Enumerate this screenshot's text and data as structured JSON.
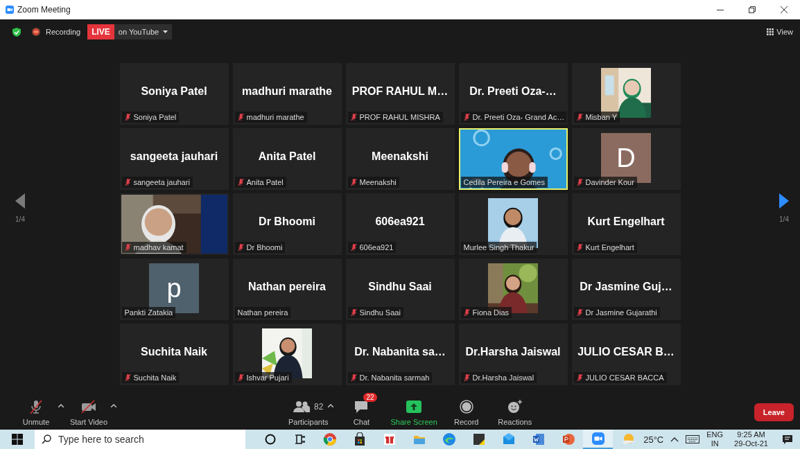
{
  "window": {
    "title": "Zoom Meeting"
  },
  "meeting_bar": {
    "recording": "Recording",
    "live": "LIVE",
    "stream": "on YouTube",
    "view": "View"
  },
  "prev_page": {
    "page": "1/4",
    "disabled": true
  },
  "next_page": {
    "page": "1/4",
    "disabled": false
  },
  "tiles": [
    {
      "kind": "name",
      "display_name": "Soniya Patel",
      "label": "Soniya Patel",
      "muted": true,
      "speaking": false
    },
    {
      "kind": "name",
      "display_name": "madhuri marathe",
      "label": "madhuri marathe",
      "muted": true,
      "speaking": false
    },
    {
      "kind": "name",
      "display_name": "PROF RAHUL M…",
      "label": "PROF RAHUL MISHRA",
      "muted": true,
      "speaking": false
    },
    {
      "kind": "name",
      "display_name": "Dr. Preeti Oza-…",
      "label": "Dr. Preeti Oza- Grand Ac…",
      "muted": true,
      "speaking": false
    },
    {
      "label": "Misban Y",
      "muted": true,
      "speaking": false
    },
    {
      "kind": "name",
      "display_name": "sangeeta jauhari",
      "label": "sangeeta jauhari",
      "muted": true,
      "speaking": false
    },
    {
      "kind": "name",
      "display_name": "Anita Patel",
      "label": "Anita Patel",
      "muted": true,
      "speaking": false
    },
    {
      "kind": "name",
      "display_name": "Meenakshi",
      "label": "Meenakshi",
      "muted": true,
      "speaking": false
    },
    {
      "kind": "video",
      "label": "Cedila Pereira e Gomes",
      "muted": false,
      "speaking": true
    },
    {
      "kind": "avatar",
      "initial": "D",
      "color": "#8b6b60",
      "label": "Davinder Kour",
      "muted": true,
      "speaking": false
    },
    {
      "kind": "video",
      "label": "madhav kamat",
      "muted": true,
      "speaking": false
    },
    {
      "kind": "name",
      "display_name": "Dr Bhoomi",
      "label": "Dr Bhoomi",
      "muted": true,
      "speaking": false
    },
    {
      "kind": "name",
      "display_name": "606ea921",
      "label": "606ea921",
      "muted": true,
      "speaking": false
    },
    {
      "label": "Murlee Singh Thakur",
      "muted": false,
      "speaking": false
    },
    {
      "kind": "name",
      "display_name": "Kurt Engelhart",
      "label": "Kurt Engelhart",
      "muted": true,
      "speaking": false
    },
    {
      "kind": "avatar",
      "initial": "p",
      "color": "#4f616d",
      "label": "Pankti Zatakia",
      "muted": false,
      "speaking": false
    },
    {
      "kind": "name",
      "display_name": "Nathan pereira",
      "label": "Nathan pereira",
      "muted": false,
      "speaking": false
    },
    {
      "kind": "name",
      "display_name": "Sindhu Saai",
      "label": "Sindhu Saai",
      "muted": true,
      "speaking": false
    },
    {
      "label": "Fiona Dias",
      "muted": true,
      "speaking": false
    },
    {
      "kind": "name",
      "display_name": "Dr Jasmine Guj…",
      "label": "Dr Jasmine Gujarathi",
      "muted": true,
      "speaking": false
    },
    {
      "kind": "name",
      "display_name": "Suchita Naik",
      "label": "Suchita Naik",
      "muted": true,
      "speaking": false
    },
    {
      "label": "Ishvar Pujari",
      "muted": true,
      "speaking": false
    },
    {
      "kind": "name",
      "display_name": "Dr. Nabanita sa…",
      "label": "Dr. Nabanita sarmah",
      "muted": true,
      "speaking": false
    },
    {
      "kind": "name",
      "display_name": "Dr.Harsha Jaiswal",
      "label": "Dr.Harsha Jaiswal",
      "muted": true,
      "speaking": false
    },
    {
      "kind": "name",
      "display_name": "JULIO CESAR B…",
      "label": "JULIO CESAR BACCA",
      "muted": true,
      "speaking": false
    }
  ],
  "toolbar": {
    "buttons": [
      {
        "kind": "mic",
        "label": "Unmute"
      },
      {
        "kind": "video",
        "label": "Start Video"
      },
      {
        "kind": "participants",
        "label": "Participants",
        "count": "82"
      },
      {
        "kind": "chat",
        "label": "Chat",
        "badge": "22"
      },
      {
        "kind": "share",
        "label": "Share Screen"
      },
      {
        "kind": "record",
        "label": "Record"
      },
      {
        "kind": "reactions",
        "label": "Reactions"
      }
    ],
    "leave": "Leave"
  },
  "taskbar": {
    "search": {
      "placeholder": "Type here to search"
    },
    "apps": [
      {
        "kind": "cortana",
        "selected": false
      },
      {
        "kind": "taskview",
        "selected": false
      },
      {
        "kind": "chrome",
        "selected": false
      },
      {
        "kind": "store",
        "selected": false
      },
      {
        "kind": "gift",
        "selected": false
      },
      {
        "kind": "explorer",
        "selected": false
      },
      {
        "kind": "edge",
        "selected": false
      },
      {
        "kind": "sticky",
        "selected": false
      },
      {
        "kind": "mail",
        "selected": false
      },
      {
        "kind": "word",
        "selected": false
      },
      {
        "kind": "powerpoint",
        "selected": false
      },
      {
        "kind": "zoom",
        "selected": true
      }
    ],
    "weather": "25°C",
    "language": "ENG",
    "region": "IN",
    "time": "9:25 AM",
    "date": "29-Oct-21"
  }
}
